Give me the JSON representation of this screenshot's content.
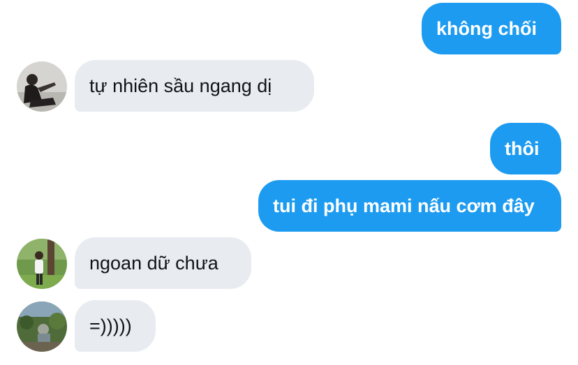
{
  "conversation": {
    "messages": [
      {
        "direction": "outgoing",
        "text": "không chối"
      },
      {
        "direction": "incoming",
        "text": "tự nhiên sầu ngang dị",
        "avatar": "avatar-person-sitting"
      },
      {
        "direction": "outgoing",
        "text": "thôi"
      },
      {
        "direction": "outgoing",
        "text": "tui đi phụ mami nấu cơm đây"
      },
      {
        "direction": "incoming",
        "text": "ngoan dữ chưa",
        "avatar": "avatar-person-under-tree"
      },
      {
        "direction": "incoming",
        "text": "=)))))",
        "avatar": "avatar-garden-photo"
      }
    ]
  },
  "colors": {
    "outgoing_bubble": "#1d9bf0",
    "incoming_bubble": "#e8ecf1",
    "outgoing_text": "#ffffff",
    "incoming_text": "#0f1419"
  }
}
